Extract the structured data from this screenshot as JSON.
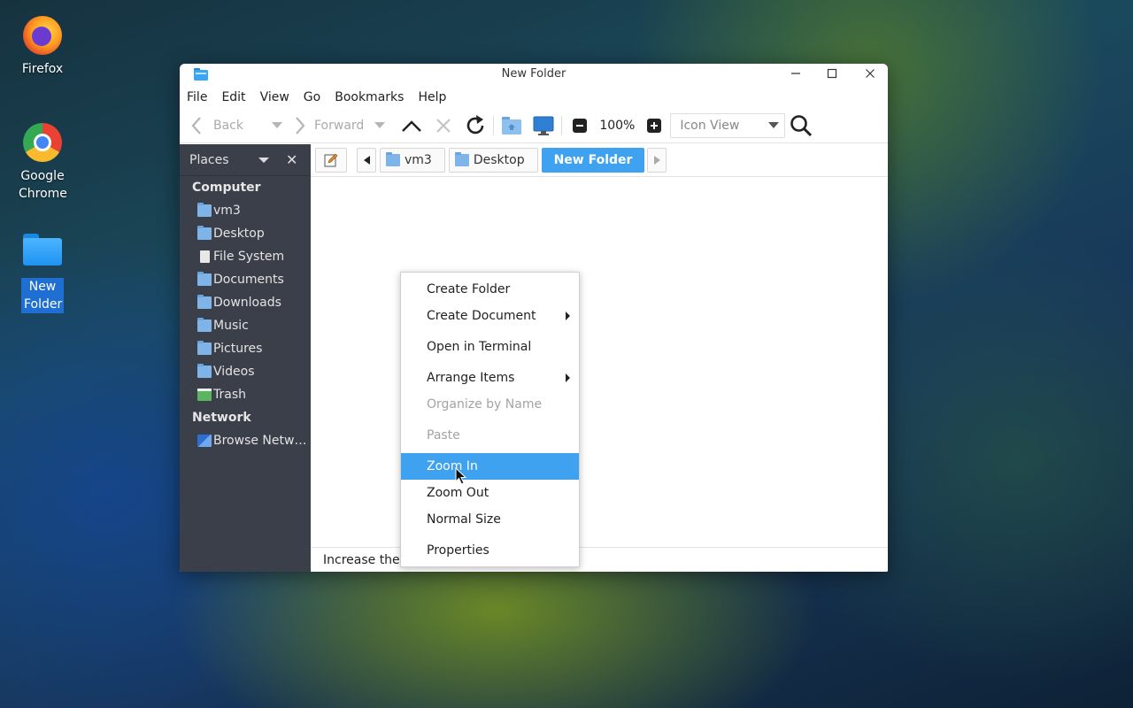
{
  "desktop": {
    "icons": [
      {
        "label": "Firefox"
      },
      {
        "label": "Google Chrome"
      },
      {
        "label": "New Folder"
      }
    ]
  },
  "window": {
    "title": "New Folder",
    "menu": [
      "File",
      "Edit",
      "View",
      "Go",
      "Bookmarks",
      "Help"
    ],
    "toolbar": {
      "back_label": "Back",
      "forward_label": "Forward",
      "zoom_level": "100%",
      "view_mode": "Icon View"
    },
    "sidebar": {
      "header": "Places",
      "groups": [
        {
          "label": "Computer"
        },
        {
          "label": "Network"
        }
      ],
      "computer_items": [
        "vm3",
        "Desktop",
        "File System",
        "Documents",
        "Downloads",
        "Music",
        "Pictures",
        "Videos",
        "Trash"
      ],
      "network_items": [
        "Browse Netw…"
      ]
    },
    "pathbar": {
      "crumbs": [
        "vm3",
        "Desktop",
        "New Folder"
      ]
    },
    "status_text": "Increase the"
  },
  "context_menu": {
    "items": [
      "Create Folder",
      "Create Document",
      "Open in Terminal",
      "Arrange Items",
      "Organize by Name",
      "Paste",
      "Zoom In",
      "Zoom Out",
      "Normal Size",
      "Properties"
    ]
  },
  "colors": {
    "accent": "#3ea2f1",
    "sidebar_bg": "#3b3f4a",
    "disabled_text": "#a3a3a3"
  }
}
